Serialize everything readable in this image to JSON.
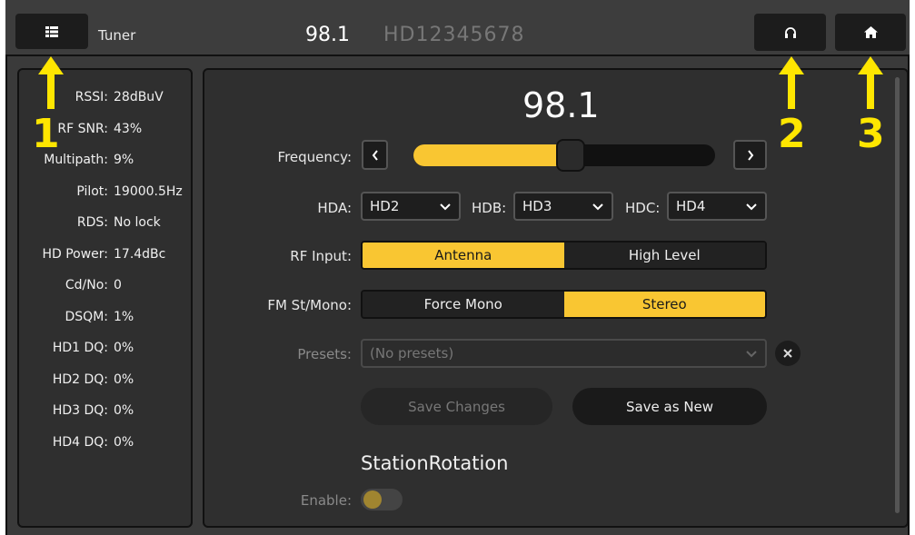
{
  "topbar": {
    "app_title": "Tuner",
    "frequency": "98.1",
    "hd_id": "HD12345678"
  },
  "stats": [
    {
      "label": "RSSI:",
      "value": "28dBuV"
    },
    {
      "label": "RF SNR:",
      "value": "43%"
    },
    {
      "label": "Multipath:",
      "value": "9%"
    },
    {
      "label": "Pilot:",
      "value": "19000.5Hz"
    },
    {
      "label": "RDS:",
      "value": "No lock"
    },
    {
      "label": "HD Power:",
      "value": "17.4dBc"
    },
    {
      "label": "Cd/No:",
      "value": "0"
    },
    {
      "label": "DSQM:",
      "value": "1%"
    },
    {
      "label": "HD1 DQ:",
      "value": "0%"
    },
    {
      "label": "HD2 DQ:",
      "value": "0%"
    },
    {
      "label": "HD3 DQ:",
      "value": "0%"
    },
    {
      "label": "HD4 DQ:",
      "value": "0%"
    }
  ],
  "main": {
    "frequency_display": "98.1",
    "frequency_label": "Frequency:",
    "slider_fraction": 0.52,
    "hda_label": "HDA:",
    "hda_value": "HD2",
    "hdb_label": "HDB:",
    "hdb_value": "HD3",
    "hdc_label": "HDC:",
    "hdc_value": "HD4",
    "rf_input_label": "RF Input:",
    "rf_input_options": [
      "Antenna",
      "High Level"
    ],
    "rf_input_selected": "Antenna",
    "fm_label": "FM St/Mono:",
    "fm_options": [
      "Force Mono",
      "Stereo"
    ],
    "fm_selected": "Stereo",
    "presets_label": "Presets:",
    "presets_value": "(No presets)",
    "save_changes": "Save Changes",
    "save_as_new": "Save as New",
    "station_rotation_title": "StationRotation",
    "enable_label": "Enable:"
  },
  "annotations": [
    "1",
    "2",
    "3"
  ],
  "colors": {
    "accent": "#f9c632",
    "arrow": "#ffe600"
  }
}
